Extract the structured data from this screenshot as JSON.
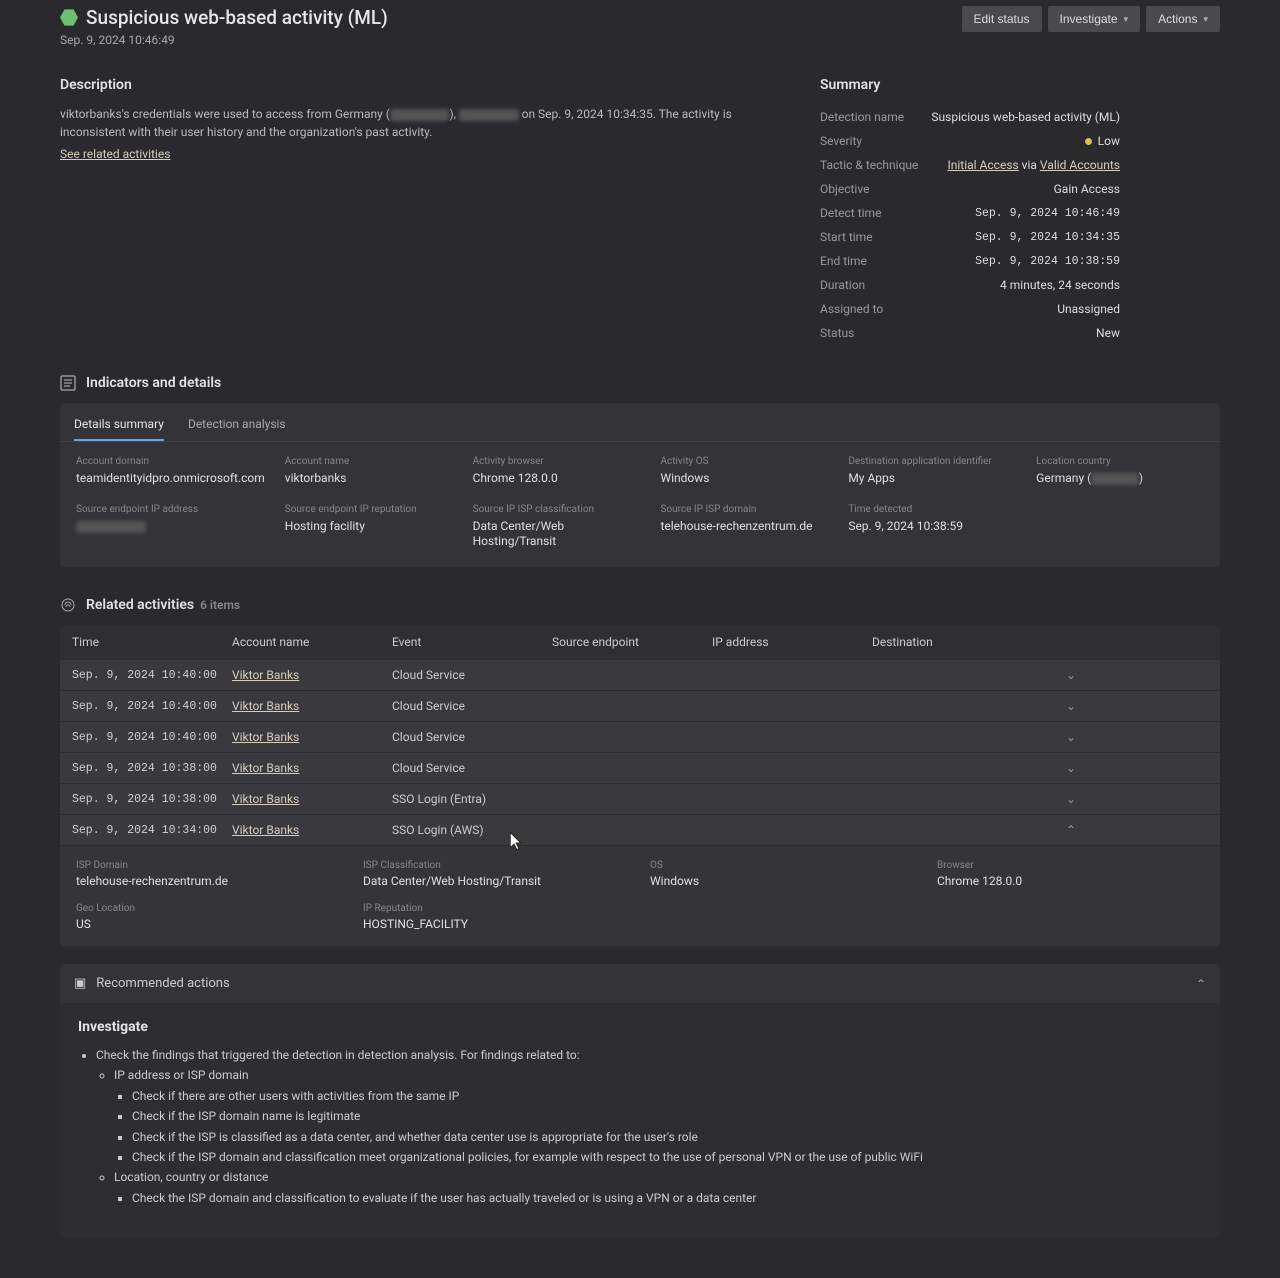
{
  "header": {
    "title": "Suspicious web-based activity (ML)",
    "timestamp": "Sep. 9, 2024 10:46:49",
    "buttons": {
      "edit": "Edit status",
      "investigate": "Investigate",
      "actions": "Actions"
    }
  },
  "description": {
    "heading": "Description",
    "prefix": "viktorbanks's credentials were used to access from Germany (",
    "mid": "), ",
    "suffix": " on Sep. 9, 2024 10:34:35. The activity is inconsistent with their user history and the organization's past activity.",
    "link": "See related activities"
  },
  "summary": {
    "heading": "Summary",
    "rows": {
      "detection_name": {
        "k": "Detection name",
        "v": "Suspicious web-based activity (ML)"
      },
      "severity": {
        "k": "Severity",
        "v": "Low"
      },
      "tactic": {
        "k": "Tactic & technique",
        "a": "Initial Access",
        "via": " via ",
        "b": "Valid Accounts"
      },
      "objective": {
        "k": "Objective",
        "v": "Gain Access"
      },
      "detect_time": {
        "k": "Detect time",
        "v": "Sep. 9, 2024 10:46:49"
      },
      "start_time": {
        "k": "Start time",
        "v": "Sep. 9, 2024 10:34:35"
      },
      "end_time": {
        "k": "End time",
        "v": "Sep. 9, 2024 10:38:59"
      },
      "duration": {
        "k": "Duration",
        "v": "4 minutes, 24 seconds"
      },
      "assigned": {
        "k": "Assigned to",
        "v": "Unassigned"
      },
      "status": {
        "k": "Status",
        "v": "New"
      }
    }
  },
  "indicators": {
    "heading": "Indicators and details",
    "tabs": {
      "details": "Details summary",
      "analysis": "Detection analysis"
    },
    "cells": {
      "account_domain": {
        "lbl": "Account domain",
        "val": "teamidentityidpro.onmicrosoft.com"
      },
      "account_name": {
        "lbl": "Account name",
        "val": "viktorbanks"
      },
      "activity_browser": {
        "lbl": "Activity browser",
        "val": "Chrome 128.0.0"
      },
      "activity_os": {
        "lbl": "Activity OS",
        "val": "Windows"
      },
      "dest_app": {
        "lbl": "Destination application identifier",
        "val": "My Apps"
      },
      "location": {
        "lbl": "Location country",
        "val": "Germany ("
      },
      "src_ip": {
        "lbl": "Source endpoint IP address",
        "val": ""
      },
      "src_rep": {
        "lbl": "Source endpoint IP reputation",
        "val": "Hosting facility"
      },
      "src_class": {
        "lbl": "Source IP ISP classification",
        "val": "Data Center/Web Hosting/Transit"
      },
      "src_isp": {
        "lbl": "Source IP ISP domain",
        "val": "telehouse-rechenzentrum.de"
      },
      "time_detected": {
        "lbl": "Time detected",
        "val": "Sep. 9, 2024 10:38:59"
      }
    }
  },
  "related": {
    "heading": "Related activities",
    "count": "6 items",
    "columns": {
      "time": "Time",
      "account": "Account name",
      "event": "Event",
      "source": "Source endpoint",
      "ip": "IP address",
      "dest": "Destination"
    },
    "rows": [
      {
        "time": "Sep. 9, 2024 10:40:00",
        "acct": "Viktor Banks",
        "event": "Cloud Service"
      },
      {
        "time": "Sep. 9, 2024 10:40:00",
        "acct": "Viktor Banks",
        "event": "Cloud Service"
      },
      {
        "time": "Sep. 9, 2024 10:40:00",
        "acct": "Viktor Banks",
        "event": "Cloud Service"
      },
      {
        "time": "Sep. 9, 2024 10:38:00",
        "acct": "Viktor Banks",
        "event": "Cloud Service"
      },
      {
        "time": "Sep. 9, 2024 10:38:00",
        "acct": "Viktor Banks",
        "event": "SSO Login (Entra)"
      },
      {
        "time": "Sep. 9, 2024 10:34:00",
        "acct": "Viktor Banks",
        "event": "SSO Login (AWS)"
      }
    ],
    "expanded": {
      "isp_domain": {
        "lbl": "ISP Domain",
        "val": "telehouse-rechenzentrum.de"
      },
      "isp_class": {
        "lbl": "ISP Classification",
        "val": "Data Center/Web Hosting/Transit"
      },
      "os": {
        "lbl": "OS",
        "val": "Windows"
      },
      "browser": {
        "lbl": "Browser",
        "val": "Chrome 128.0.0"
      },
      "geo": {
        "lbl": "Geo Location",
        "val": "US"
      },
      "ip_rep": {
        "lbl": "IP Reputation",
        "val": "HOSTING_FACILITY"
      }
    }
  },
  "recommended": {
    "heading": "Recommended actions",
    "investigate": "Investigate",
    "line1": "Check the findings that triggered the detection in detection analysis. For findings related to:",
    "ip_or_isp": "IP address or ISP domain",
    "b1": "Check if there are other users with activities from the same IP",
    "b2": "Check if the ISP domain name is legitimate",
    "b3": "Check if the ISP is classified as a data center, and whether data center use is appropriate for the user's role",
    "b4": "Check if the ISP domain and classification meet organizational policies, for example with respect to the use of personal VPN or the use of public WiFi",
    "loc": "Location, country or distance",
    "b5": "Check the ISP domain and classification to evaluate if the user has actually traveled or is using a VPN or a data center"
  }
}
